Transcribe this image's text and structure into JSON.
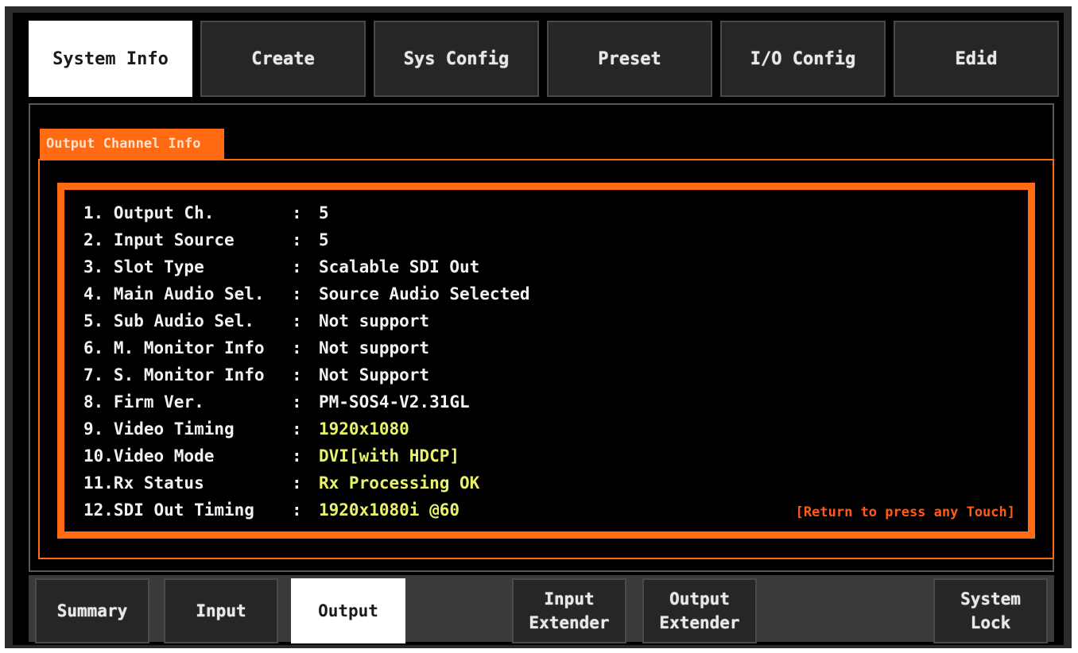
{
  "top_tabs": [
    {
      "label": "System Info",
      "active": true
    },
    {
      "label": "Create",
      "active": false
    },
    {
      "label": "Sys Config",
      "active": false
    },
    {
      "label": "Preset",
      "active": false
    },
    {
      "label": "I/O Config",
      "active": false
    },
    {
      "label": "Edid",
      "active": false
    }
  ],
  "section": {
    "title": "Output Channel Info"
  },
  "info": [
    {
      "label": "1. Output Ch.",
      "sep": ":",
      "value": "5",
      "highlight": false
    },
    {
      "label": "2. Input Source",
      "sep": ":",
      "value": "5",
      "highlight": false
    },
    {
      "label": "3. Slot Type",
      "sep": ":",
      "value": "Scalable SDI Out",
      "highlight": false
    },
    {
      "label": "4. Main Audio Sel.",
      "sep": ":",
      "value": "Source Audio Selected",
      "highlight": false
    },
    {
      "label": "5. Sub Audio Sel.",
      "sep": ":",
      "value": "Not support",
      "highlight": false
    },
    {
      "label": "6. M. Monitor Info",
      "sep": ":",
      "value": "Not support",
      "highlight": false
    },
    {
      "label": "7. S. Monitor Info",
      "sep": ":",
      "value": "Not Support",
      "highlight": false
    },
    {
      "label": "8. Firm Ver.",
      "sep": ":",
      "value": "PM-SOS4-V2.31GL",
      "highlight": false
    },
    {
      "label": "9. Video Timing",
      "sep": ":",
      "value": "1920x1080",
      "highlight": true
    },
    {
      "label": "10.Video Mode",
      "sep": ":",
      "value": "DVI[with HDCP]",
      "highlight": true
    },
    {
      "label": "11.Rx Status",
      "sep": ":",
      "value": "Rx Processing OK",
      "highlight": true
    },
    {
      "label": "12.SDI Out Timing",
      "sep": ":",
      "value": "1920x1080i @60",
      "highlight": true
    }
  ],
  "return_hint": "[Return to press any Touch]",
  "bottom_tabs": [
    {
      "line1": "Summary",
      "line2": "",
      "active": false
    },
    {
      "line1": "Input",
      "line2": "",
      "active": false
    },
    {
      "line1": "Output",
      "line2": "",
      "active": true
    },
    {
      "line1": "Input",
      "line2": "Extender",
      "active": false
    },
    {
      "line1": "Output",
      "line2": "Extender",
      "active": false
    },
    {
      "line1": "System",
      "line2": "Lock",
      "active": false
    }
  ],
  "colors": {
    "accent_orange": "#ff6a13",
    "highlight_yellow": "#e8f26a",
    "hint_red": "#ff5a1a"
  }
}
